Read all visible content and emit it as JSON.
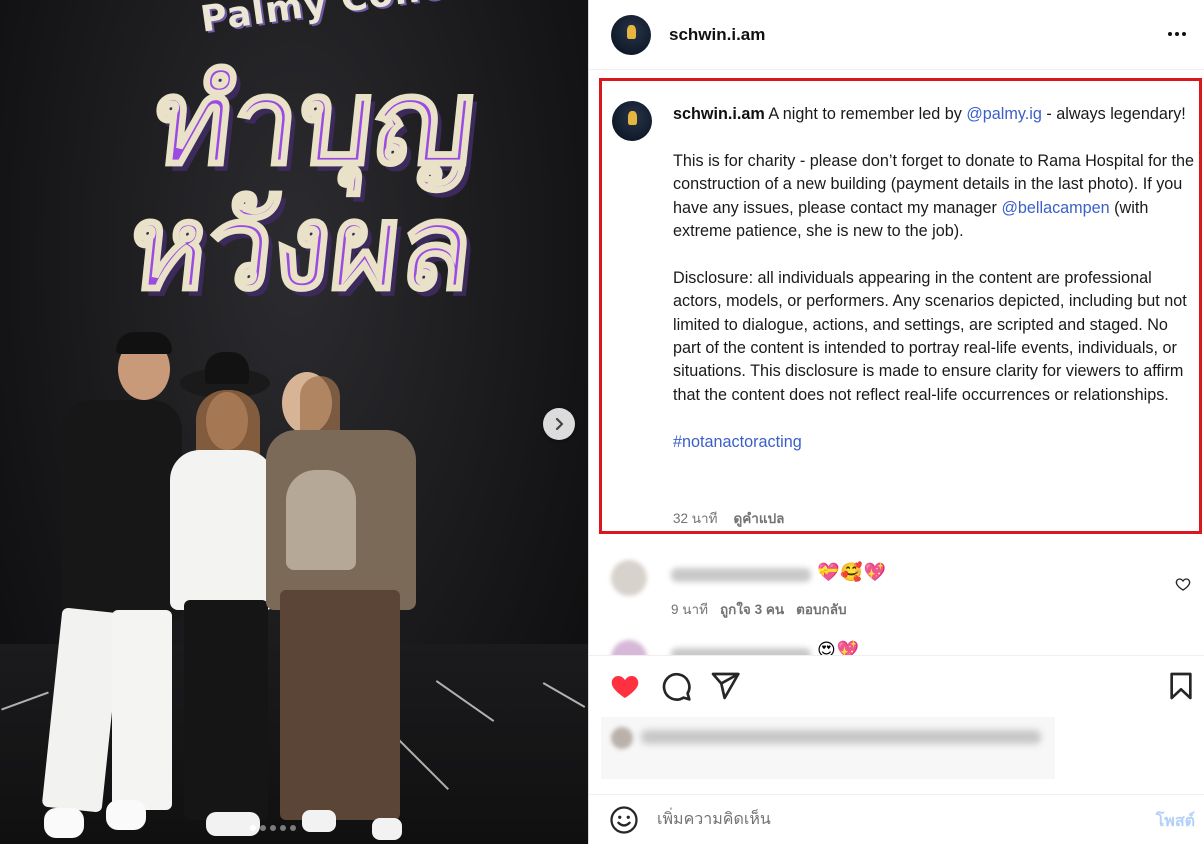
{
  "media": {
    "poster_top_text": "Palmy Concert",
    "poster_main_text": "ทำบุญหวังผล",
    "slide_count": 5,
    "active_slide": 1
  },
  "header": {
    "username": "schwin.i.am",
    "more_icon": "ellipsis-icon"
  },
  "caption": {
    "username": "schwin.i.am",
    "intro_text": "A night to remember led by",
    "mention_1": "@palmy.ig",
    "intro_tail": "- always legendary!",
    "para2_text": "This is for charity - please don’t forget to donate to Rama Hospital for the construction of a new building (payment details in the last photo). If you have any issues, please contact my manager",
    "mention_2": "@bellacampen",
    "para2_tail": "(with extreme patience, she is new to the job).",
    "disclosure": "Disclosure: all individuals appearing in the content are professional actors, models, or performers. Any scenarios depicted, including but not limited to dialogue, actions, and settings, are scripted and staged. No part of the content is intended to portray real-life events, individuals, or situations. This disclosure is made to ensure clarity for viewers to affirm that the content does not reflect real-life occurrences or relationships.",
    "hashtag": "#notanactoracting",
    "time": "32 นาที",
    "translate": "ดูคำแปล"
  },
  "comments": [
    {
      "emoji": "💝🥰💖",
      "time": "9 นาที",
      "likes": "ถูกใจ 3 คน",
      "reply": "ตอบกลับ"
    },
    {
      "emoji": "😍💖",
      "time": "",
      "likes": "",
      "reply": ""
    }
  ],
  "actions": {
    "liked": true,
    "like_color": "#ff3040"
  },
  "comment_bar": {
    "placeholder": "เพิ่มความคิดเห็น",
    "post_label": "โพสต์"
  },
  "colors": {
    "highlight_border": "#d9171c",
    "link": "#3b5fc7",
    "post_button": "#b3d1f8"
  }
}
